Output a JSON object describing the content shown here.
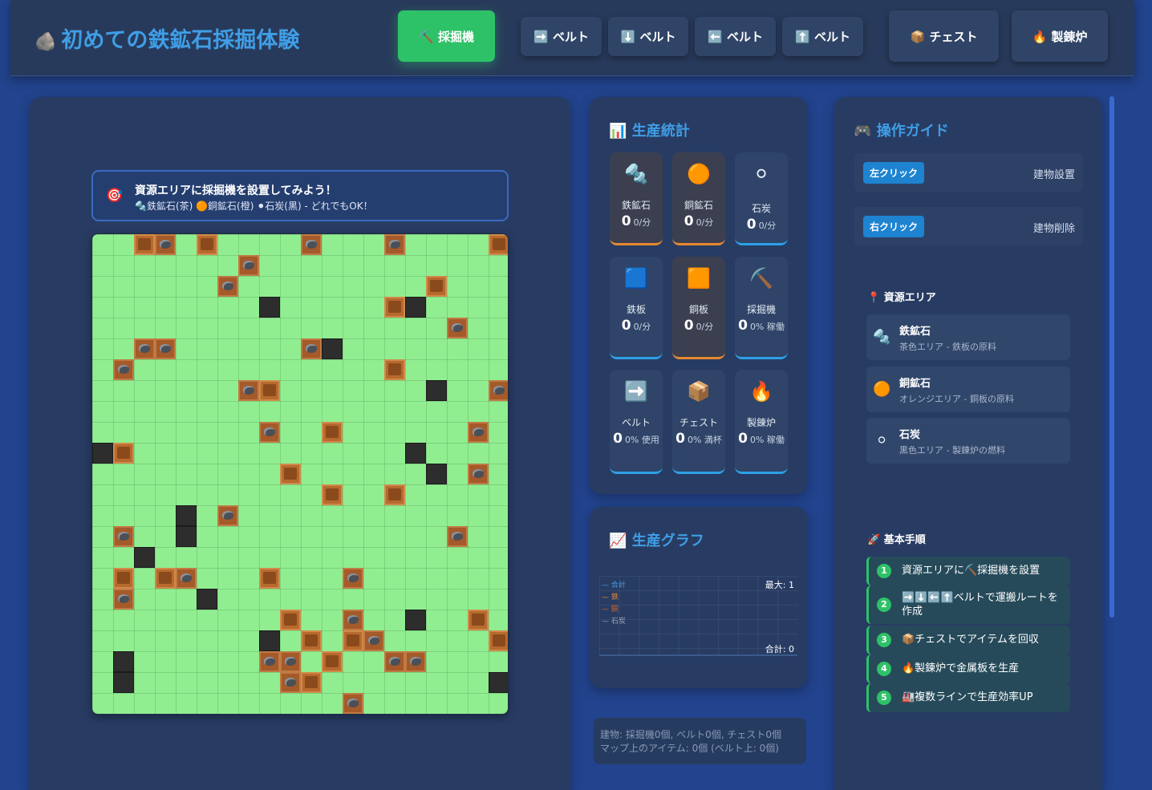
{
  "app": {
    "title_icon": "🪨",
    "title": "初めての鉄鉱石採掘体験"
  },
  "toolbar": [
    {
      "name": "miner",
      "label": "⛏️ 採掘機",
      "active": true
    },
    {
      "name": "belt-right",
      "label": "➡️ ベルト",
      "active": false
    },
    {
      "name": "belt-down",
      "label": "⬇️ ベルト",
      "active": false
    },
    {
      "name": "belt-left",
      "label": "⬅️ ベルト",
      "active": false
    },
    {
      "name": "belt-up",
      "label": "⬆️ ベルト",
      "active": false
    },
    {
      "name": "chest",
      "label": "📦 チェスト",
      "active": false
    },
    {
      "name": "furnace",
      "label": "🔥 製錬炉",
      "active": false
    }
  ],
  "goal": {
    "icon": "🎯",
    "title": "資源エリアに採掘機を設置してみよう！",
    "hint": "🔩鉄鉱石(茶) 🟠銅鉱石(橙) ⚫石炭(黒) - どれでもOK！"
  },
  "map": {
    "cols": 20,
    "rows": 23,
    "tiles": [
      [
        2,
        0,
        "ore"
      ],
      [
        3,
        0,
        "iron"
      ],
      [
        5,
        0,
        "ore"
      ],
      [
        10,
        0,
        "iron"
      ],
      [
        14,
        0,
        "iron"
      ],
      [
        19,
        0,
        "ore"
      ],
      [
        7,
        1,
        "iron"
      ],
      [
        6,
        2,
        "iron"
      ],
      [
        16,
        2,
        "ore"
      ],
      [
        8,
        3,
        "coal"
      ],
      [
        14,
        3,
        "ore"
      ],
      [
        15,
        3,
        "coal"
      ],
      [
        17,
        4,
        "iron"
      ],
      [
        2,
        5,
        "iron"
      ],
      [
        3,
        5,
        "iron"
      ],
      [
        10,
        5,
        "iron"
      ],
      [
        11,
        5,
        "coal"
      ],
      [
        1,
        6,
        "iron"
      ],
      [
        14,
        6,
        "ore"
      ],
      [
        7,
        7,
        "iron"
      ],
      [
        8,
        7,
        "ore"
      ],
      [
        16,
        7,
        "coal"
      ],
      [
        19,
        7,
        "iron"
      ],
      [
        8,
        9,
        "iron"
      ],
      [
        11,
        9,
        "ore"
      ],
      [
        18,
        9,
        "iron"
      ],
      [
        0,
        10,
        "coal"
      ],
      [
        1,
        10,
        "ore"
      ],
      [
        15,
        10,
        "coal"
      ],
      [
        9,
        11,
        "ore"
      ],
      [
        16,
        11,
        "coal"
      ],
      [
        18,
        11,
        "iron"
      ],
      [
        11,
        12,
        "ore"
      ],
      [
        14,
        12,
        "ore"
      ],
      [
        4,
        13,
        "coal"
      ],
      [
        6,
        13,
        "iron"
      ],
      [
        1,
        14,
        "iron"
      ],
      [
        4,
        14,
        "coal"
      ],
      [
        17,
        14,
        "iron"
      ],
      [
        2,
        15,
        "coal"
      ],
      [
        1,
        16,
        "ore"
      ],
      [
        3,
        16,
        "ore"
      ],
      [
        4,
        16,
        "iron"
      ],
      [
        8,
        16,
        "ore"
      ],
      [
        12,
        16,
        "iron"
      ],
      [
        1,
        17,
        "iron"
      ],
      [
        5,
        17,
        "coal"
      ],
      [
        9,
        18,
        "ore"
      ],
      [
        12,
        18,
        "iron"
      ],
      [
        15,
        18,
        "coal"
      ],
      [
        18,
        18,
        "ore"
      ],
      [
        8,
        19,
        "coal"
      ],
      [
        10,
        19,
        "ore"
      ],
      [
        12,
        19,
        "ore"
      ],
      [
        13,
        19,
        "iron"
      ],
      [
        19,
        19,
        "ore"
      ],
      [
        1,
        20,
        "coal"
      ],
      [
        8,
        20,
        "iron"
      ],
      [
        9,
        20,
        "iron"
      ],
      [
        11,
        20,
        "ore"
      ],
      [
        14,
        20,
        "iron"
      ],
      [
        15,
        20,
        "iron"
      ],
      [
        1,
        21,
        "coal"
      ],
      [
        9,
        21,
        "iron"
      ],
      [
        10,
        21,
        "ore"
      ],
      [
        19,
        21,
        "coal"
      ],
      [
        12,
        22,
        "iron"
      ]
    ]
  },
  "stats": {
    "title_icon": "📊",
    "title": "生産統計",
    "items": [
      {
        "icon": "🔩",
        "label": "鉄鉱石",
        "value": "0",
        "unit": "0/分",
        "style": "orange"
      },
      {
        "icon": "🟠",
        "label": "銅鉱石",
        "value": "0",
        "unit": "0/分",
        "style": "orange"
      },
      {
        "icon": "⚪",
        "label": "石炭",
        "value": "0",
        "unit": "0/分",
        "style": "blue"
      },
      {
        "icon": "🟦",
        "label": "鉄板",
        "value": "0",
        "unit": "0/分",
        "style": "blue"
      },
      {
        "icon": "🟧",
        "label": "銅板",
        "value": "0",
        "unit": "0/分",
        "style": "orange"
      },
      {
        "icon": "⛏️",
        "label": "採掘機",
        "value": "0",
        "unit": "0% 稼働",
        "style": "blue"
      },
      {
        "icon": "➡️",
        "label": "ベルト",
        "value": "0",
        "unit": "0% 使用",
        "style": "blue"
      },
      {
        "icon": "📦",
        "label": "チェスト",
        "value": "0",
        "unit": "0% 満杯",
        "style": "blue"
      },
      {
        "icon": "🔥",
        "label": "製錬炉",
        "value": "0",
        "unit": "0% 稼働",
        "style": "blue"
      }
    ]
  },
  "graph": {
    "title_icon": "📈",
    "title": "生産グラフ",
    "legend": [
      {
        "label": "— 合計",
        "color": "#3f9ee6"
      },
      {
        "label": "— 鉄",
        "color": "#e8892f"
      },
      {
        "label": "— 銅",
        "color": "#d9652a"
      },
      {
        "label": "— 石炭",
        "color": "#9aa4b5"
      }
    ],
    "max": "最大: 1",
    "total": "合計: 0"
  },
  "info": {
    "buildings": "建物: 採掘機0個, ベルト0個, チェスト0個",
    "items": "マップ上のアイテム: 0個 (ベルト上: 0個)"
  },
  "guide": {
    "title_icon": "🎮",
    "title": "操作ガイド",
    "keys": [
      {
        "key": "左クリック",
        "desc": "建物設置"
      },
      {
        "key": "右クリック",
        "desc": "建物削除"
      }
    ],
    "resources_title": "📍 資源エリア",
    "resources": [
      {
        "icon": "🔩",
        "name": "鉄鉱石",
        "desc": "茶色エリア - 鉄板の原料"
      },
      {
        "icon": "🟠",
        "name": "銅鉱石",
        "desc": "オレンジエリア - 銅板の原料"
      },
      {
        "icon": "⚪",
        "name": "石炭",
        "desc": "黒色エリア - 製錬炉の燃料"
      }
    ],
    "steps_title": "🚀 基本手順",
    "steps": [
      {
        "num": "1",
        "text": "資源エリアに⛏️採掘機を設置"
      },
      {
        "num": "2",
        "text": "➡️⬇️⬅️⬆️ベルトで運搬ルートを作成"
      },
      {
        "num": "3",
        "text": "📦チェストでアイテムを回収"
      },
      {
        "num": "4",
        "text": "🔥製錬炉で金属板を生産"
      },
      {
        "num": "5",
        "text": "🏭複数ラインで生産効率UP"
      }
    ]
  }
}
